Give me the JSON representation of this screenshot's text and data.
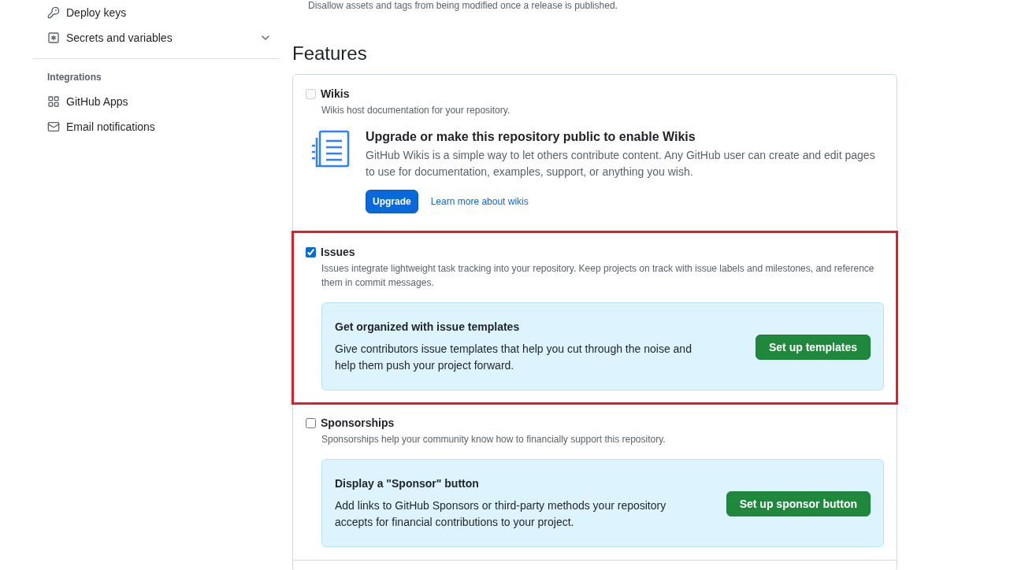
{
  "sidebar": {
    "items": [
      {
        "label": "Deploy keys",
        "kind": "key",
        "expandable": false
      },
      {
        "label": "Secrets and variables",
        "kind": "secret",
        "expandable": true
      }
    ],
    "groups": [
      {
        "heading": "Integrations",
        "items": [
          {
            "label": "GitHub Apps",
            "kind": "apps",
            "expandable": false
          },
          {
            "label": "Email notifications",
            "kind": "mail",
            "expandable": false
          }
        ]
      }
    ]
  },
  "previous_setting": {
    "description": "Disallow assets and tags from being modified once a release is published."
  },
  "features": {
    "heading": "Features",
    "items": [
      {
        "kind": "upsell",
        "label": "Wikis",
        "checked": false,
        "disabled": true,
        "highlighted": false,
        "description": "Wikis host documentation for your repository.",
        "callout": {
          "title": "Upgrade or make this repository public to enable Wikis",
          "text": "GitHub Wikis is a simple way to let others contribute content. Any GitHub user can create and edit pages to use for documentation, examples, support, or anything you wish.",
          "button": "Upgrade",
          "link": "Learn more about wikis"
        }
      },
      {
        "kind": "banner",
        "label": "Issues",
        "checked": true,
        "disabled": false,
        "highlighted": true,
        "description": "Issues integrate lightweight task tracking into your repository. Keep projects on track with issue labels and milestones, and reference them in commit messages.",
        "callout": {
          "title": "Get organized with issue templates",
          "text": "Give contributors issue templates that help you cut through the noise and help them push your project forward.",
          "button": "Set up templates"
        }
      },
      {
        "kind": "banner",
        "label": "Sponsorships",
        "checked": false,
        "disabled": false,
        "highlighted": false,
        "description": "Sponsorships help your community know how to financially support this repository.",
        "callout": {
          "title": "Display a \"Sponsor\" button",
          "text": "Add links to GitHub Sponsors or third-party methods your repository accepts for financial contributions to your project.",
          "button": "Set up sponsor button"
        }
      }
    ]
  }
}
